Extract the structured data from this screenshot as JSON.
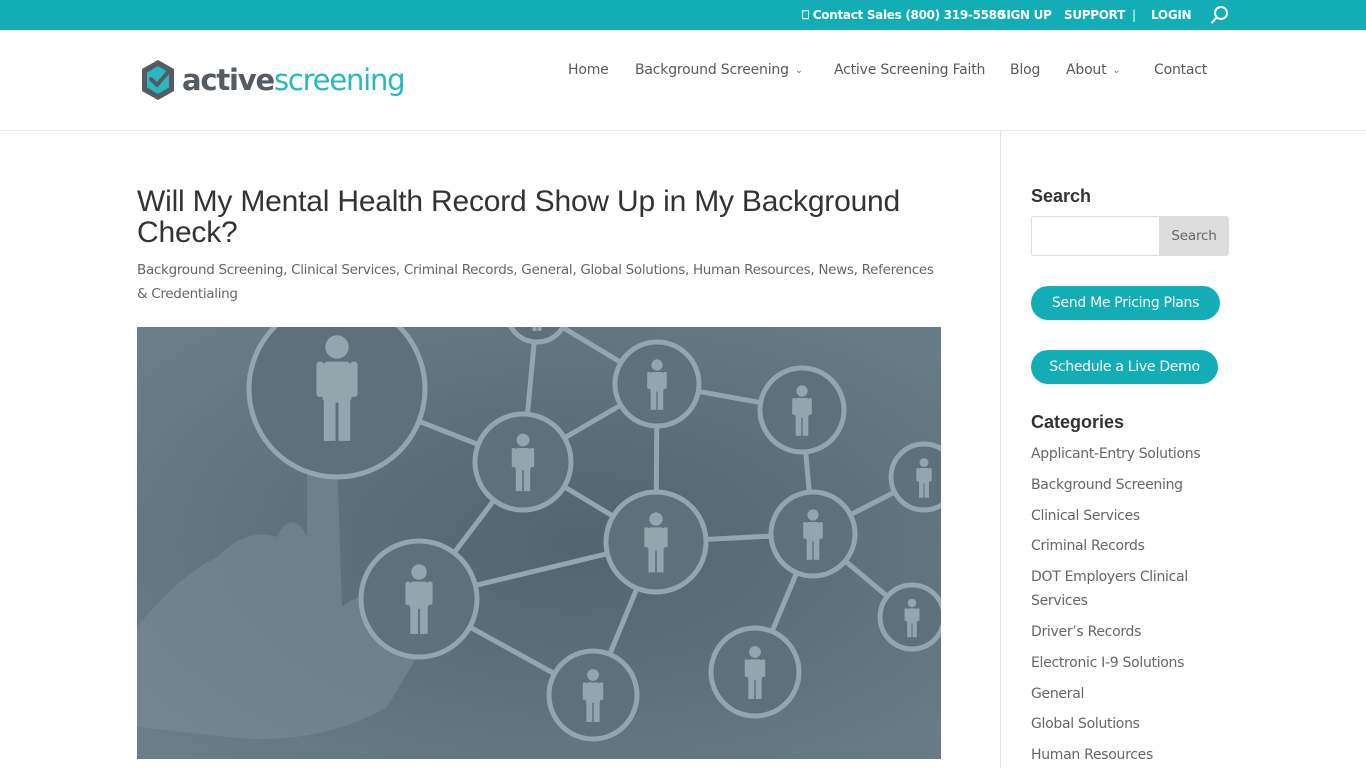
{
  "topbar": {
    "contact_icon": "phone-icon",
    "contact": "⎕ Contact Sales (800) 319-5580",
    "signup": "SIGN UP",
    "support": "SUPPORT",
    "separator": "|",
    "login": "LOGIN",
    "search_icon": "search-icon",
    "background_color": "#13adb5"
  },
  "header": {
    "logo": {
      "word_bold": "active",
      "word_light": "screening",
      "icon": "hexagon-check-icon"
    },
    "nav": [
      {
        "label": "Home",
        "has_dropdown": false
      },
      {
        "label": "Background Screening",
        "has_dropdown": true
      },
      {
        "label": "Active Screening Faith",
        "has_dropdown": false
      },
      {
        "label": "Blog",
        "has_dropdown": false
      },
      {
        "label": "About",
        "has_dropdown": true
      },
      {
        "label": "Contact",
        "has_dropdown": false
      }
    ],
    "chevron": "⌄"
  },
  "post": {
    "title": "Will My Mental Health Record Show Up in My Background Check?",
    "categories": [
      "Background Screening",
      "Clinical Services",
      "Criminal Records",
      "General",
      "Global Solutions",
      "Human Resources",
      "News",
      "References & Credentialing"
    ],
    "featured_image": "network-of-people-icons-hand-pointing"
  },
  "sidebar": {
    "search_heading": "Search",
    "search_value": "",
    "search_placeholder": "",
    "search_button": "Search",
    "cta_pricing": "Send Me Pricing Plans",
    "cta_demo": "Schedule a Live Demo",
    "categories_heading": "Categories",
    "categories": [
      "Applicant-Entry Solutions",
      "Background Screening",
      "Clinical Services",
      "Criminal Records",
      "DOT Employers Clinical Services",
      "Driver’s Records",
      "Electronic I-9 Solutions",
      "General",
      "Global Solutions",
      "Human Resources"
    ],
    "accent_color": "#13adb5"
  }
}
